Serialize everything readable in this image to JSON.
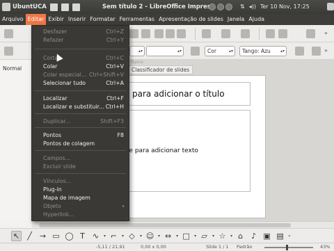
{
  "top_panel": {
    "app_name": "UbuntUCA",
    "window_title": "Sem título 2 - LibreOffice Impress",
    "network": "⇅",
    "volume": "◂))",
    "datetime": "Ter 10 Nov, 17:25"
  },
  "menubar": {
    "items": [
      "Arquivo",
      "Editar",
      "Exibir",
      "Inserir",
      "Formatar",
      "Ferramentas",
      "Apresentação de slides",
      "Janela",
      "Ajuda"
    ],
    "active": "Editar"
  },
  "toolbar2": {
    "color_combo": "Cor",
    "gradient_combo": "Tango: Azu"
  },
  "left_panel": {
    "view_tab": "Normal"
  },
  "workspace": {
    "outline_tab": "Tópico",
    "sorter_tab": "Classificador de slides",
    "title_placeholder": "para adicionar o título",
    "content_placeholder": "que para adicionar texto"
  },
  "edit_menu": {
    "items": [
      {
        "label": "Desfazer",
        "shortcut": "Ctrl+Z",
        "enabled": false
      },
      {
        "label": "Refazer",
        "shortcut": "Ctrl+Y",
        "enabled": false
      },
      {
        "label": "Cortar",
        "shortcut": "Ctrl+C",
        "enabled": false
      },
      {
        "label": "Colar",
        "shortcut": "Ctrl+V",
        "enabled": true
      },
      {
        "label": "Colar especial...",
        "shortcut": "Ctrl+Shift+V",
        "enabled": false
      },
      {
        "label": "Selecionar tudo",
        "shortcut": "Ctrl+A",
        "enabled": true
      },
      {
        "label": "Localizar",
        "shortcut": "Ctrl+F",
        "enabled": true
      },
      {
        "label": "Localizar e substituir...",
        "shortcut": "Ctrl+H",
        "enabled": true
      },
      {
        "label": "Duplicar...",
        "shortcut": "Shift+F3",
        "enabled": false
      },
      {
        "label": "Pontos",
        "shortcut": "F8",
        "enabled": true
      },
      {
        "label": "Pontos de colagem",
        "shortcut": "",
        "enabled": true
      },
      {
        "label": "Campos...",
        "shortcut": "",
        "enabled": false
      },
      {
        "label": "Excluir slide",
        "shortcut": "",
        "enabled": false
      },
      {
        "label": "Vínculos...",
        "shortcut": "",
        "enabled": false
      },
      {
        "label": "Plug-in",
        "shortcut": "",
        "enabled": true
      },
      {
        "label": "Mapa de imagem",
        "shortcut": "",
        "enabled": true
      },
      {
        "label": "Objeto",
        "shortcut": "",
        "enabled": false
      },
      {
        "label": "Hyperlink...",
        "shortcut": "",
        "enabled": false
      }
    ]
  },
  "statusbar": {
    "position": "-5,11 / 21,91",
    "size": "0,00 x 0,00",
    "slide": "Slide 1 / 1",
    "layout": "Padrão",
    "zoom": "43%"
  },
  "colors": {
    "panel": "#3e3d39",
    "accent": "#f07746",
    "menu_bg": "#3a3935"
  }
}
